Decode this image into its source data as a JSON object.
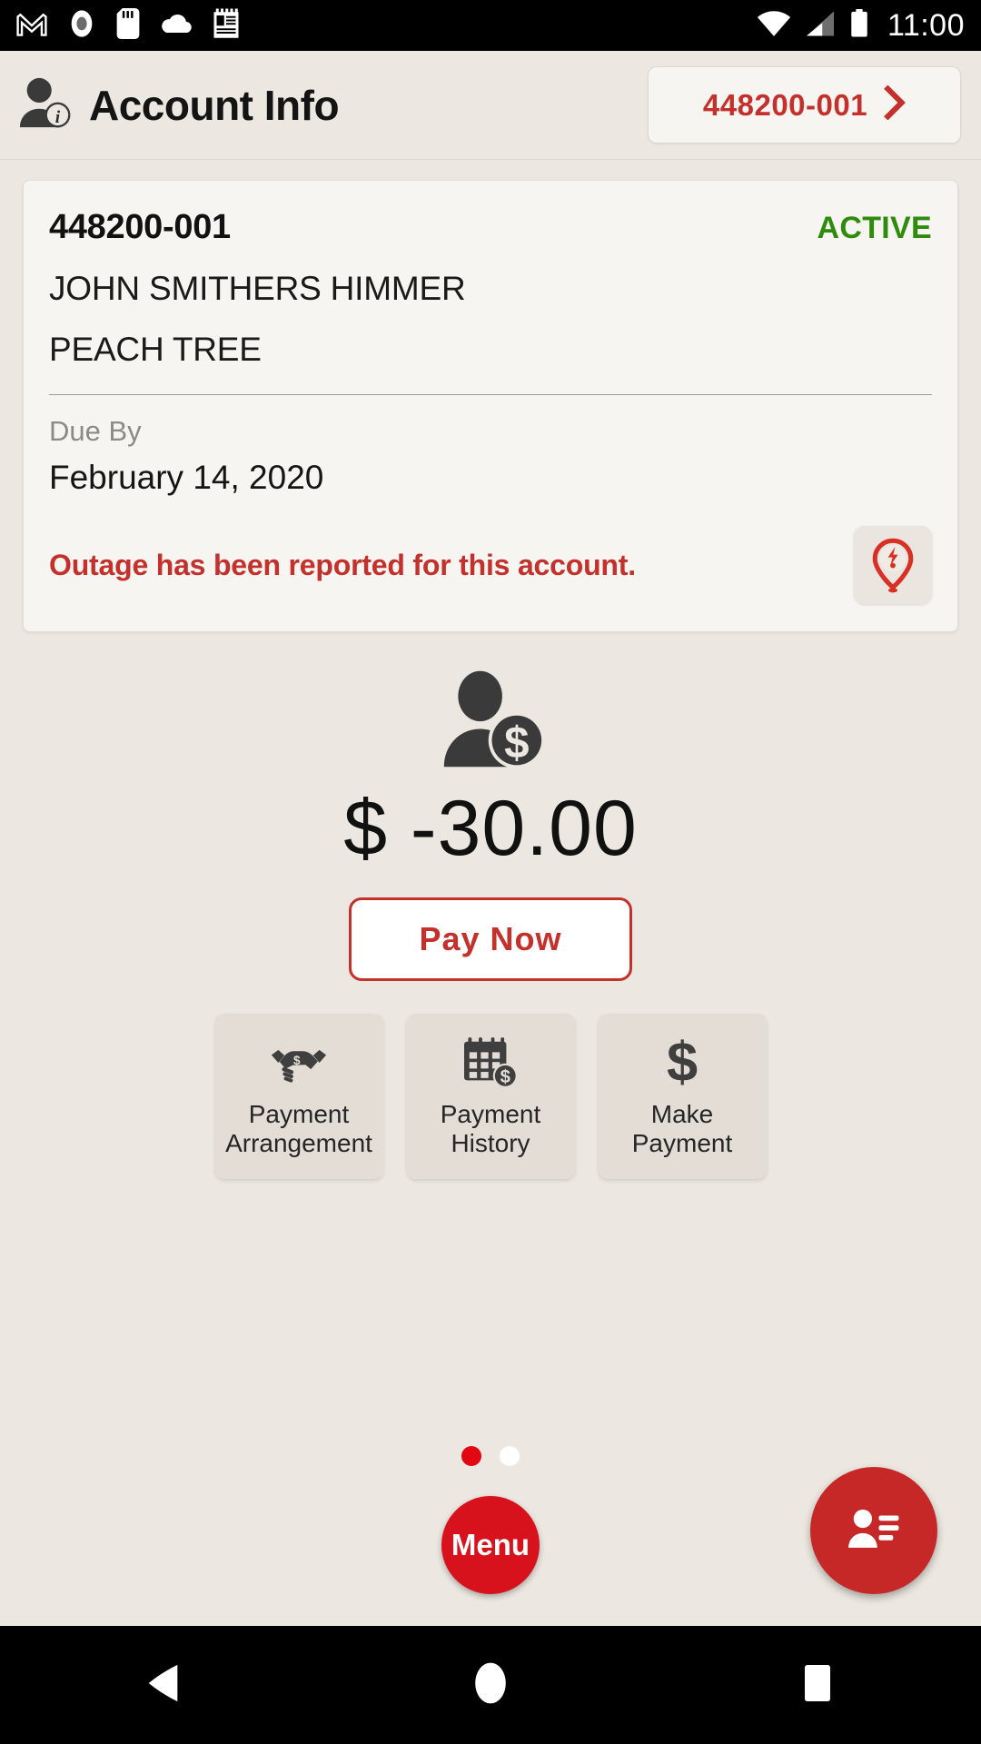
{
  "status_bar": {
    "icons": [
      "gmail-icon",
      "record-icon",
      "sd-card-icon",
      "cloud-icon",
      "notes-icon"
    ],
    "wifi_icon": "wifi-icon",
    "signal_icon": "cell-signal-icon",
    "battery_icon": "battery-icon",
    "clock": "11:00"
  },
  "header": {
    "icon": "account-info-icon",
    "title": "Account Info",
    "account_chip": {
      "label": "448200-001",
      "chevron": "chevron-right-icon"
    }
  },
  "account_card": {
    "account_number": "448200-001",
    "status": "ACTIVE",
    "status_color": "#2e8b0b",
    "customer_name": "JOHN SMITHERS HIMMER",
    "address": "PEACH TREE",
    "due_label": "Due By",
    "due_date": "February 14, 2020",
    "outage_message": "Outage has been reported for this account.",
    "outage_color": "#c4302b",
    "outage_icon": "outage-pin-icon"
  },
  "balance": {
    "icon": "customer-balance-icon",
    "amount": "$ -30.00",
    "pay_now_label": "Pay Now",
    "accent_color": "#c4302b"
  },
  "tiles": [
    {
      "icon": "handshake-icon",
      "line1": "Payment",
      "line2": "Arrangement"
    },
    {
      "icon": "calendar-dollar-icon",
      "line1": "Payment",
      "line2": "History"
    },
    {
      "icon": "dollar-sign-icon",
      "line1": "Make",
      "line2": "Payment"
    }
  ],
  "pager": {
    "total": 2,
    "active_index": 0,
    "active_color": "#e30613",
    "inactive_color": "#ffffff"
  },
  "menu_fab": {
    "label": "Menu",
    "color": "#d8121c"
  },
  "contacts_fab": {
    "icon": "contact-card-icon",
    "color": "#c62828"
  },
  "nav_bar": {
    "back": "back-triangle-icon",
    "home": "home-circle-icon",
    "recents": "recents-square-icon"
  }
}
